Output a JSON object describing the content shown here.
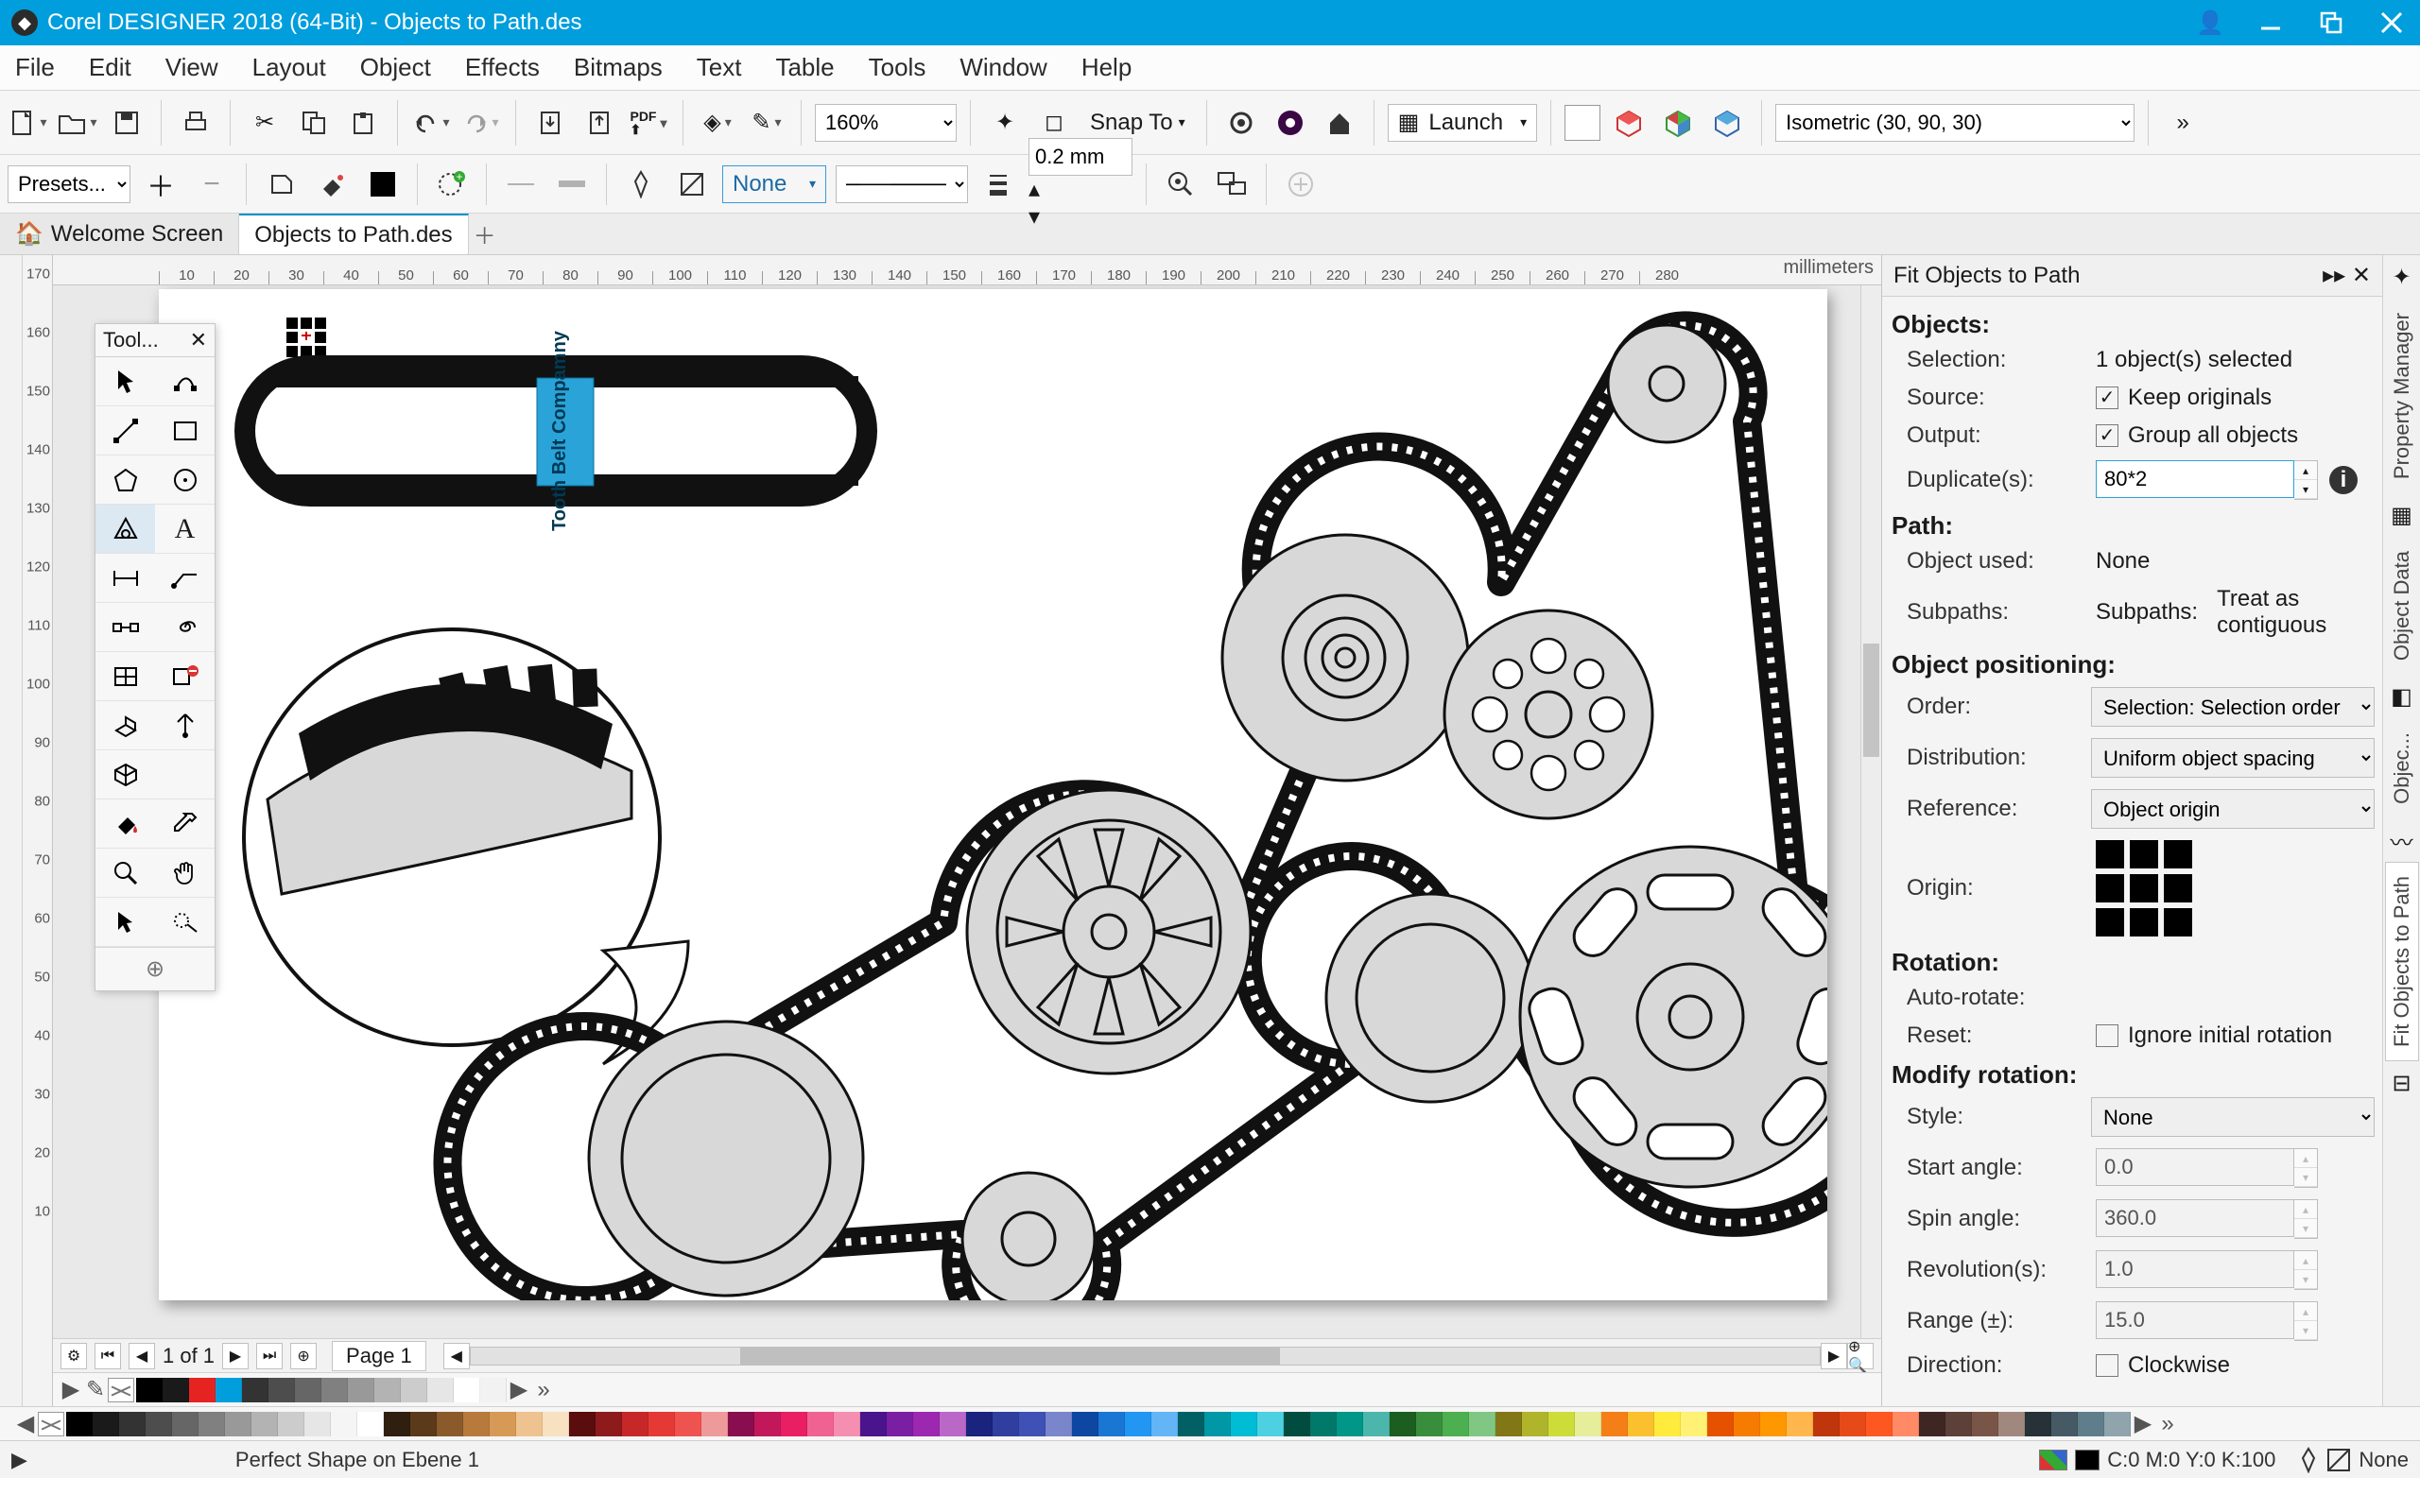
{
  "titlebar": {
    "app": "Corel DESIGNER 2018 (64-Bit)",
    "doc": "Objects to Path.des"
  },
  "menu": [
    "File",
    "Edit",
    "View",
    "Layout",
    "Object",
    "Effects",
    "Bitmaps",
    "Text",
    "Table",
    "Tools",
    "Window",
    "Help"
  ],
  "toolbar1": {
    "zoom": "160%",
    "snapto": "Snap To",
    "launch": "Launch",
    "projection": "Isometric (30, 90, 30)"
  },
  "toolbar2": {
    "presets": "Presets...",
    "outline": "None",
    "thickness": "0.2 mm"
  },
  "tabs": {
    "welcome": "Welcome Screen",
    "doc": "Objects to Path.des"
  },
  "ruler_units": "millimeters",
  "ruler_h": [
    "10",
    "40",
    "70",
    "100",
    "130",
    "140",
    "150",
    "160",
    "170",
    "180",
    "190",
    "200",
    "210",
    "220",
    "230",
    "240",
    "250",
    "260",
    "270",
    "280"
  ],
  "ruler_h_full": [
    "10",
    "20",
    "30",
    "40",
    "50",
    "60",
    "70",
    "80",
    "90",
    "100",
    "110",
    "120",
    "130",
    "140",
    "150",
    "160",
    "170",
    "180",
    "190",
    "200",
    "210",
    "220",
    "230",
    "240",
    "250",
    "260",
    "270",
    "280"
  ],
  "ruler_v": [
    "170",
    "160",
    "150",
    "140",
    "130",
    "120",
    "110",
    "100",
    "90",
    "80",
    "70",
    "60",
    "50",
    "40",
    "30",
    "20",
    "10"
  ],
  "toolbox_title": "Tool...",
  "canvas_logo": "Tooth Belt Compamny",
  "pager": {
    "pos": "1  of  1",
    "page": "Page 1"
  },
  "docker": {
    "title": "Fit Objects to Path",
    "objects": {
      "heading": "Objects:",
      "selection_l": "Selection:",
      "selection_v": "1 object(s) selected",
      "source_l": "Source:",
      "source_v": "Keep originals",
      "output_l": "Output:",
      "output_v": "Group all objects",
      "dup_l": "Duplicate(s):",
      "dup_v": "80*2"
    },
    "path": {
      "heading": "Path:",
      "used_l": "Object used:",
      "used_v": "None",
      "sub_l": "Subpaths:",
      "sub_v1": "Subpaths:",
      "sub_v2": "Treat as contiguous"
    },
    "positioning": {
      "heading": "Object positioning:",
      "order_l": "Order:",
      "order_v": "Selection: Selection order",
      "dist_l": "Distribution:",
      "dist_v": "Uniform object spacing",
      "ref_l": "Reference:",
      "ref_v": "Object origin",
      "origin_l": "Origin:"
    },
    "rotation": {
      "heading": "Rotation:",
      "auto_l": "Auto-rotate:",
      "reset_l": "Reset:",
      "reset_v": "Ignore initial rotation"
    },
    "modify": {
      "heading": "Modify rotation:",
      "style_l": "Style:",
      "style_v": "None",
      "start_l": "Start angle:",
      "start_v": "0.0",
      "spin_l": "Spin angle:",
      "spin_v": "360.0",
      "rev_l": "Revolution(s):",
      "rev_v": "1.0",
      "range_l": "Range (±):",
      "range_v": "15.0",
      "dir_l": "Direction:",
      "dir_v": "Clockwise"
    }
  },
  "vtabs": [
    "Property Manager",
    "Object Data",
    "Objec...",
    "Fit Objects to Path"
  ],
  "status": {
    "msg": "Perfect Shape on Ebene 1",
    "fill": "C:0 M:0 Y:0 K:100",
    "outline": "None"
  },
  "palette_top": [
    "#000000",
    "#1a1a1a",
    "#e52421",
    "#009edc",
    "#333333",
    "#4d4d4d",
    "#666666",
    "#808080",
    "#999999",
    "#b3b3b3",
    "#cccccc",
    "#e6e6e6",
    "#ffffff",
    "#f2f2f2"
  ],
  "palette_bottom": [
    "#000000",
    "#1a1a1a",
    "#333333",
    "#4d4d4d",
    "#666666",
    "#808080",
    "#999999",
    "#b3b3b3",
    "#cccccc",
    "#e6e6e6",
    "#f5f5f5",
    "#ffffff",
    "#2e1f0f",
    "#5a3a18",
    "#8a5a2b",
    "#b87a3c",
    "#d79a56",
    "#efc38f",
    "#f7e1c0",
    "#5a0d0d",
    "#8e1b1b",
    "#c62828",
    "#e53935",
    "#ef5350",
    "#ef9a9a",
    "#880e4f",
    "#c2185b",
    "#e91e63",
    "#f06292",
    "#f48fb1",
    "#4a148c",
    "#7b1fa2",
    "#9c27b0",
    "#ba68c8",
    "#1a237e",
    "#303f9f",
    "#3f51b5",
    "#7986cb",
    "#0d47a1",
    "#1976d2",
    "#2196f3",
    "#64b5f6",
    "#006064",
    "#0097a7",
    "#00bcd4",
    "#4dd0e1",
    "#004d40",
    "#00796b",
    "#009688",
    "#4db6ac",
    "#1b5e20",
    "#388e3c",
    "#4caf50",
    "#81c784",
    "#827717",
    "#afb42b",
    "#cddc39",
    "#e6ee9c",
    "#f57f17",
    "#fbc02d",
    "#ffeb3b",
    "#fff176",
    "#e65100",
    "#f57c00",
    "#ff9800",
    "#ffb74d",
    "#bf360c",
    "#e64a19",
    "#ff5722",
    "#ff8a65",
    "#3e2723",
    "#5d4037",
    "#795548",
    "#a1887f",
    "#263238",
    "#455a64",
    "#607d8b",
    "#90a4ae"
  ]
}
